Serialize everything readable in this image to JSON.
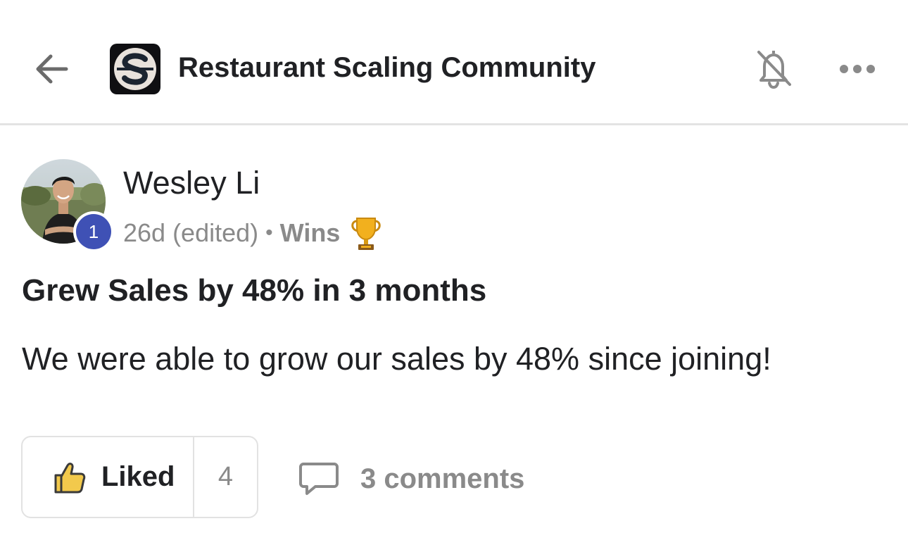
{
  "header": {
    "title": "Restaurant Scaling Community",
    "back_icon": "arrow-left-icon",
    "logo_icon": "community-logo-s",
    "notification_icon": "bell-off-icon",
    "more_icon": "more-horizontal-icon"
  },
  "post": {
    "author": "Wesley Li",
    "level": "1",
    "time": "26d (edited)",
    "separator": "•",
    "category": "Wins",
    "category_icon": "trophy-icon",
    "title": "Grew Sales by 48% in 3 months",
    "body": "We were able to grow our sales by 48% since joining!"
  },
  "actions": {
    "like_label": "Liked",
    "like_count": "4",
    "like_icon": "thumbs-up-icon",
    "comments_label": "3 comments",
    "comments_icon": "comment-icon"
  },
  "colors": {
    "level_badge": "#3f51b5",
    "liked_thumb": "#f2c94c",
    "muted_text": "#8a8a8a",
    "divider": "#e3e3e3"
  }
}
